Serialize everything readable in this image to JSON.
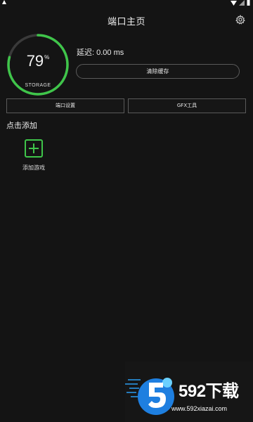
{
  "header": {
    "title": "端口主页",
    "settings_icon": "gear-icon"
  },
  "storage": {
    "value": "79",
    "unit": "%",
    "label": "STORAGE",
    "percent": 79,
    "accent_color": "#3fc54a"
  },
  "latency": {
    "text": "延迟: 0.00 ms"
  },
  "actions": {
    "clear_cache": "清除缓存",
    "port_settings": "端口设置",
    "gfx_tool": "GFX工具"
  },
  "games": {
    "section_title": "点击添加",
    "add_label": "添加游戏",
    "add_icon": "plus-icon"
  },
  "watermark": {
    "brand": "592下载",
    "url": "www.592xiazai.com"
  },
  "colors": {
    "background": "#141414",
    "accent": "#3fc54a",
    "border": "#5a5a5a"
  }
}
